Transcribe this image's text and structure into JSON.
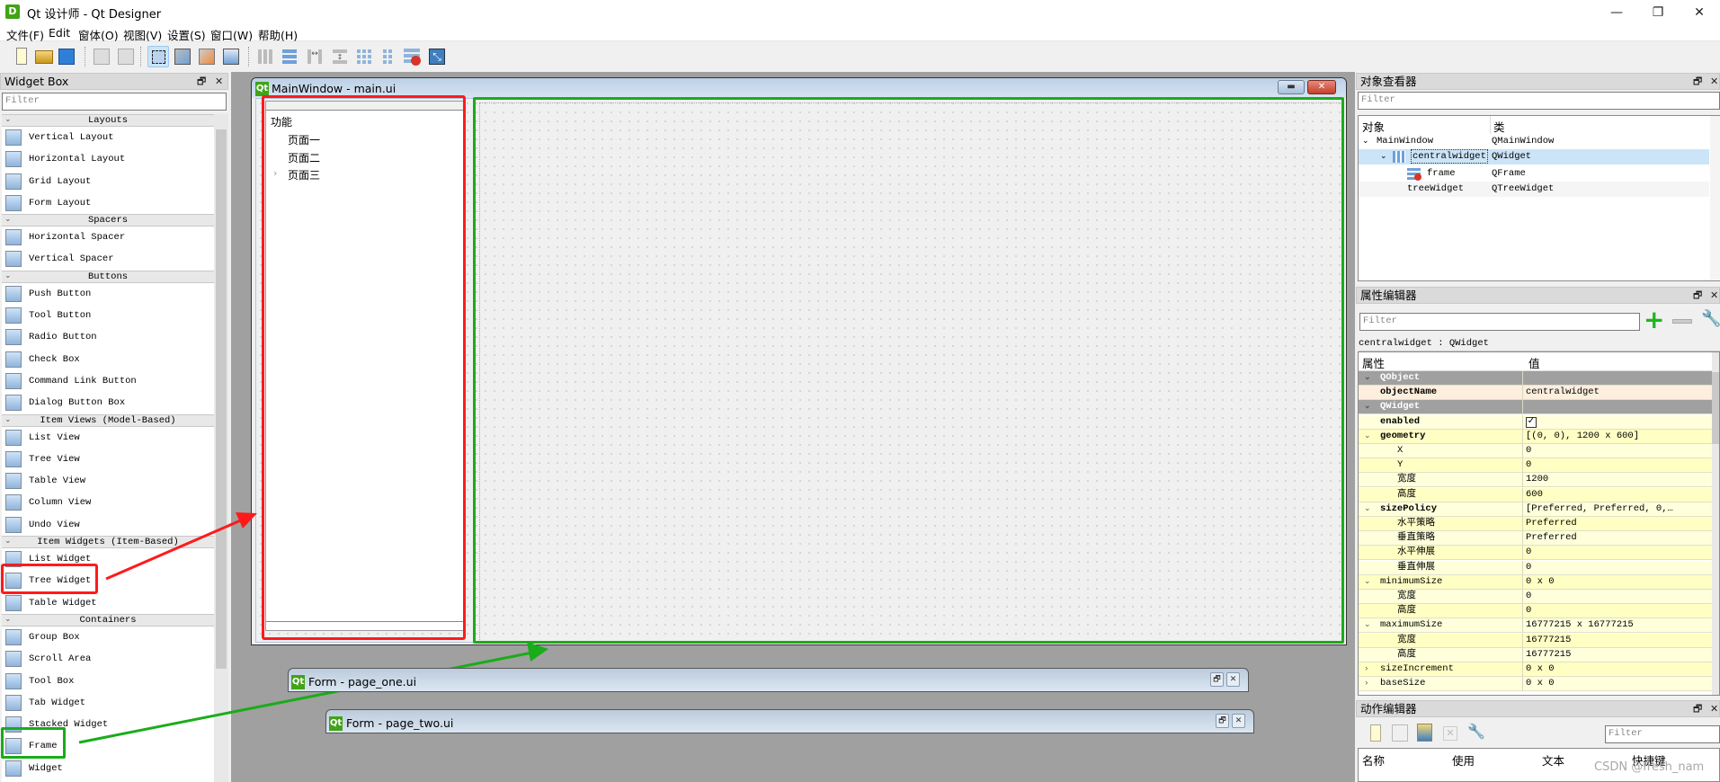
{
  "app": {
    "title": "Qt 设计师 - Qt Designer",
    "icon_letter": "D",
    "window_controls": [
      "minimize-icon",
      "restore-icon",
      "close-icon"
    ]
  },
  "menu": [
    "文件(F)",
    "Edit",
    "窗体(O)",
    "视图(V)",
    "设置(S)",
    "窗口(W)",
    "帮助(H)"
  ],
  "toolbar": [
    "new-file-icon",
    "open-folder-icon",
    "save-icon",
    "bring-to-front-icon",
    "send-to-back-icon",
    "edit-widgets-icon",
    "edit-signals-slots-icon",
    "edit-buddies-icon",
    "edit-tab-order-icon",
    "layout-horizontal-icon",
    "layout-vertical-icon",
    "layout-horizontal-splitter-icon",
    "layout-vertical-splitter-icon",
    "layout-grid-icon",
    "layout-form-icon",
    "break-layout-icon",
    "adjust-size-icon"
  ],
  "widget_box": {
    "title": "Widget Box",
    "filter_placeholder": "Filter",
    "categories": [
      {
        "name": "Layouts",
        "items": [
          "Vertical Layout",
          "Horizontal Layout",
          "Grid Layout",
          "Form Layout"
        ]
      },
      {
        "name": "Spacers",
        "items": [
          "Horizontal Spacer",
          "Vertical Spacer"
        ]
      },
      {
        "name": "Buttons",
        "items": [
          "Push Button",
          "Tool Button",
          "Radio Button",
          "Check Box",
          "Command Link Button",
          "Dialog Button Box"
        ]
      },
      {
        "name": "Item Views (Model-Based)",
        "items": [
          "List View",
          "Tree View",
          "Table View",
          "Column View",
          "Undo View"
        ]
      },
      {
        "name": "Item Widgets (Item-Based)",
        "items": [
          "List Widget",
          "Tree Widget",
          "Table Widget"
        ]
      },
      {
        "name": "Containers",
        "items": [
          "Group Box",
          "Scroll Area",
          "Tool Box",
          "Tab Widget",
          "Stacked Widget",
          "Frame",
          "Widget"
        ]
      }
    ],
    "highlighted": {
      "red": "Tree Widget",
      "green": "Frame"
    }
  },
  "main_window": {
    "title": "MainWindow - main.ui",
    "icon_text": "Qt",
    "tree": {
      "header": "功能",
      "items": [
        {
          "label": "页面一",
          "has_children": false
        },
        {
          "label": "页面二",
          "has_children": false
        },
        {
          "label": "页面三",
          "has_children": true
        }
      ]
    }
  },
  "forms": [
    {
      "title": "Form - page_one.ui"
    },
    {
      "title": "Form - page_two.ui"
    }
  ],
  "object_inspector": {
    "title": "对象查看器",
    "filter_placeholder": "Filter",
    "columns": [
      "对象",
      "类"
    ],
    "rows": [
      {
        "object": "MainWindow",
        "class": "QMainWindow",
        "expanded": true
      },
      {
        "object": "centralwidget",
        "class": "QWidget",
        "expanded": true,
        "selected": true
      },
      {
        "object": "frame",
        "class": "QFrame"
      },
      {
        "object": "treeWidget",
        "class": "QTreeWidget"
      }
    ]
  },
  "property_editor": {
    "title": "属性编辑器",
    "filter_placeholder": "Filter",
    "context": "centralwidget : QWidget",
    "columns": [
      "属性",
      "值"
    ],
    "rows": [
      {
        "type": "group",
        "name": "QObject",
        "expanded": true
      },
      {
        "type": "prop",
        "name": "objectName",
        "value": "centralwidget",
        "bold": true
      },
      {
        "type": "group",
        "name": "QWidget",
        "expanded": true
      },
      {
        "type": "prop",
        "name": "enabled",
        "value": "",
        "checked": true,
        "bold": true
      },
      {
        "type": "prop",
        "name": "geometry",
        "value": "[(0, 0), 1200 x 600]",
        "bold": true,
        "expanded": true
      },
      {
        "type": "sub",
        "name": "X",
        "value": "0"
      },
      {
        "type": "sub",
        "name": "Y",
        "value": "0"
      },
      {
        "type": "sub",
        "name": "宽度",
        "value": "1200"
      },
      {
        "type": "sub",
        "name": "高度",
        "value": "600"
      },
      {
        "type": "prop",
        "name": "sizePolicy",
        "value": "[Preferred, Preferred, 0,…",
        "bold": true,
        "expanded": true
      },
      {
        "type": "sub",
        "name": "水平策略",
        "value": "Preferred"
      },
      {
        "type": "sub",
        "name": "垂直策略",
        "value": "Preferred"
      },
      {
        "type": "sub",
        "name": "水平伸展",
        "value": "0"
      },
      {
        "type": "sub",
        "name": "垂直伸展",
        "value": "0"
      },
      {
        "type": "prop",
        "name": "minimumSize",
        "value": "0 x 0",
        "expanded": true
      },
      {
        "type": "sub",
        "name": "宽度",
        "value": "0"
      },
      {
        "type": "sub",
        "name": "高度",
        "value": "0"
      },
      {
        "type": "prop",
        "name": "maximumSize",
        "value": "16777215 x 16777215",
        "expanded": true
      },
      {
        "type": "sub",
        "name": "宽度",
        "value": "16777215"
      },
      {
        "type": "sub",
        "name": "高度",
        "value": "16777215"
      },
      {
        "type": "prop",
        "name": "sizeIncrement",
        "value": "0 x 0",
        "expanded": false
      },
      {
        "type": "prop",
        "name": "baseSize",
        "value": "0 x 0",
        "expanded": false
      }
    ]
  },
  "action_editor": {
    "title": "动作编辑器",
    "filter_placeholder": "Filter",
    "columns": [
      "名称",
      "使用",
      "文本",
      "快捷键"
    ],
    "toolbar": [
      "new-action-icon",
      "copy-action-icon",
      "paste-action-icon",
      "delete-action-icon",
      "configure-icon"
    ]
  },
  "watermark": "CSDN @fresh_nam",
  "colors": {
    "annotation_red": "#ff1a1a",
    "annotation_green": "#1aac1a",
    "selection": "#cce4f7",
    "mdi_background": "#a0a0a0"
  }
}
